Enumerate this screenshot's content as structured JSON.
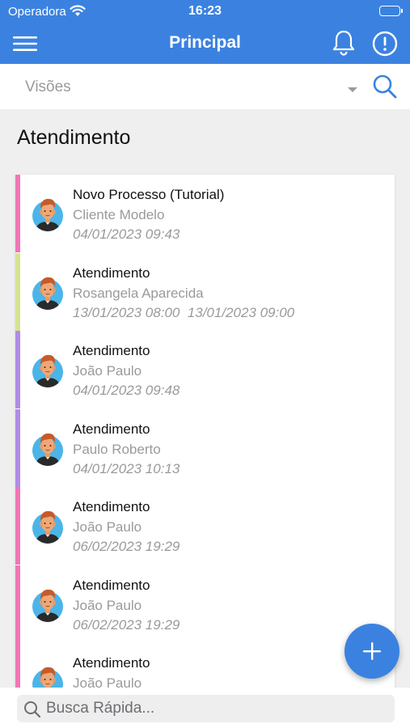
{
  "status": {
    "carrier": "Operadora",
    "time": "16:23"
  },
  "navbar": {
    "title": "Principal"
  },
  "search": {
    "views_label": "Visões"
  },
  "section": {
    "title": "Atendimento"
  },
  "items": [
    {
      "title": "Novo Processo (Tutorial)",
      "subtitle": "Cliente Modelo",
      "date": "04/01/2023 09:43",
      "color": "#f276b5"
    },
    {
      "title": "Atendimento",
      "subtitle": "Rosangela Aparecida",
      "date": "13/01/2023 08:00  13/01/2023 09:00",
      "color": "#d5e48f"
    },
    {
      "title": "Atendimento",
      "subtitle": "João Paulo",
      "date": "04/01/2023 09:48",
      "color": "#b08ce8"
    },
    {
      "title": "Atendimento",
      "subtitle": "Paulo Roberto",
      "date": "04/01/2023 10:13",
      "color": "#b08ce8"
    },
    {
      "title": "Atendimento",
      "subtitle": "João Paulo",
      "date": "06/02/2023 19:29",
      "color": "#f276b5"
    },
    {
      "title": "Atendimento",
      "subtitle": "João Paulo",
      "date": "06/02/2023 19:29",
      "color": "#f276b5"
    },
    {
      "title": "Atendimento",
      "subtitle": "João Paulo",
      "date": "",
      "color": "#f276b5"
    }
  ],
  "quick_search": {
    "placeholder": "Busca Rápida..."
  },
  "theme": {
    "primary": "#3b82e0"
  }
}
